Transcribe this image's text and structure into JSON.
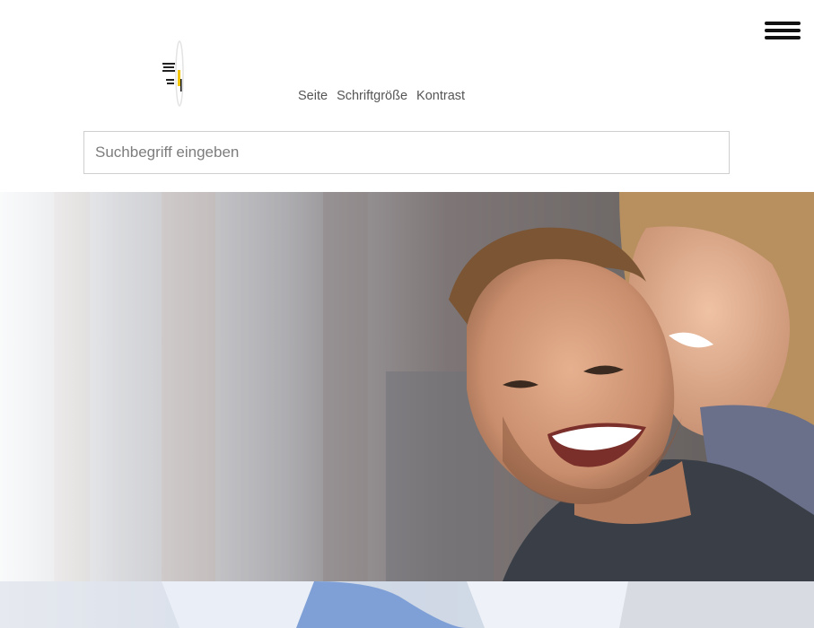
{
  "header": {
    "menu_icon": "hamburger-menu-icon",
    "logo_icon": "site-logo"
  },
  "a11y_nav": {
    "items": [
      {
        "label": "Seite"
      },
      {
        "label": "Schriftgröße"
      },
      {
        "label": "Kontrast"
      }
    ]
  },
  "search": {
    "placeholder": "Suchbegriff eingeben",
    "value": ""
  },
  "colors": {
    "background": "#ffffff",
    "text": "#555555",
    "search_border": "#cfcfcf",
    "menu_icon": "#111111"
  }
}
